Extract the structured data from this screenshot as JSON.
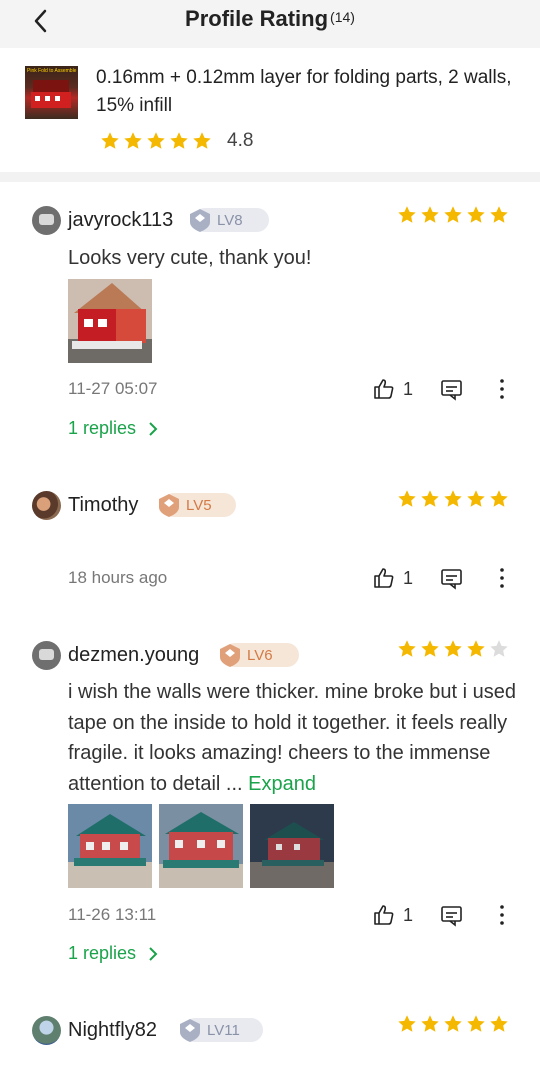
{
  "header": {
    "title": "Profile Rating",
    "count": "(14)"
  },
  "product": {
    "thumb_text": "Pink Fold to Assemble",
    "title": "0.16mm + 0.12mm layer for folding parts, 2 walls, 15% infill",
    "rating": "4.8",
    "stars": 5
  },
  "colors": {
    "star": "#f5b800",
    "star_empty": "#dcdcdc",
    "accent": "#1aa34a"
  },
  "reviews": [
    {
      "name": "javyrock113",
      "level": "LV8",
      "badge": "silver",
      "stars": 5,
      "text": "Looks very cute, thank you!",
      "photos": 1,
      "time": "11-27 05:07",
      "likes": "1",
      "replies": "1 replies"
    },
    {
      "name": "Timothy",
      "level": "LV5",
      "badge": "bronze",
      "stars": 5,
      "text": "",
      "photos": 0,
      "time": "18 hours ago",
      "likes": "1",
      "replies": ""
    },
    {
      "name": "dezmen.young",
      "level": "LV6",
      "badge": "bronze",
      "stars": 4,
      "text": "i wish the walls were thicker. mine broke but i used tape on the inside to hold it together. it feels really fragile. it looks amazing! cheers to the immense attention to detail ...",
      "expand": "Expand",
      "photos": 3,
      "time": "11-26 13:11",
      "likes": "1",
      "replies": "1 replies"
    },
    {
      "name": "Nightfly82",
      "level": "LV11",
      "badge": "silver",
      "stars": 5
    }
  ]
}
